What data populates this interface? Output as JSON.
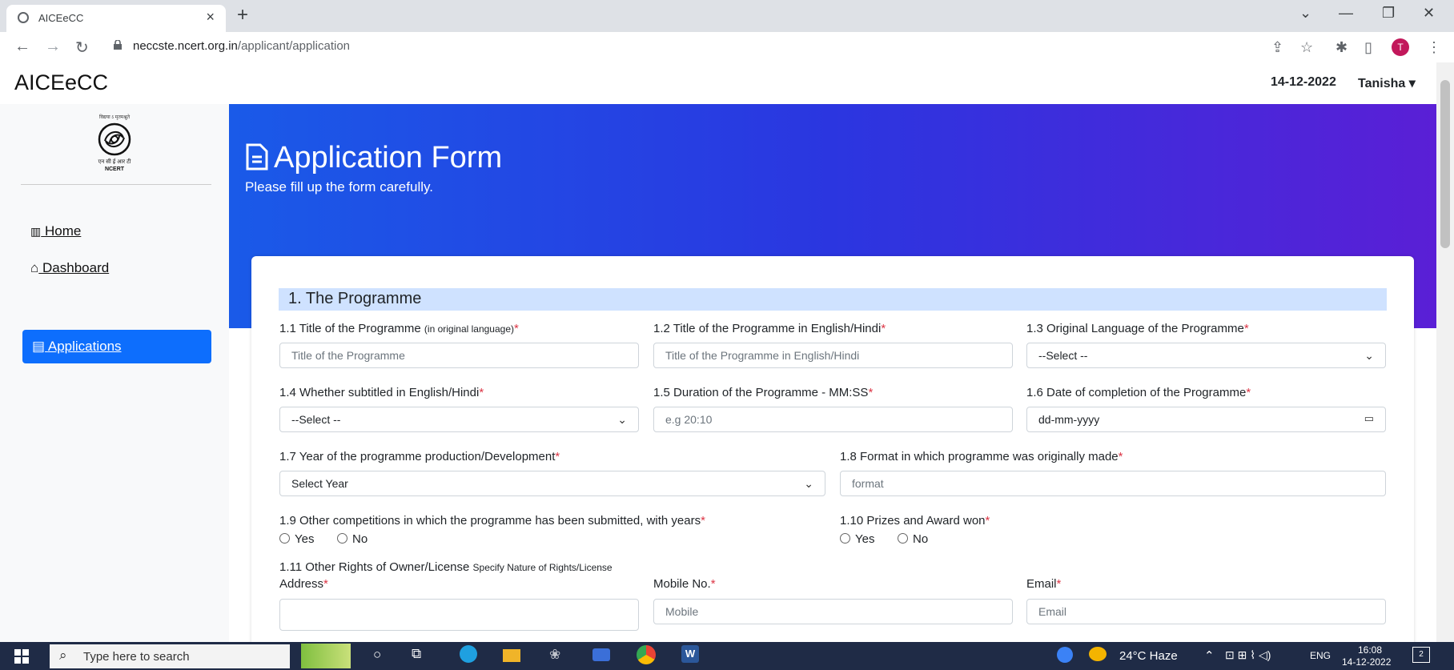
{
  "browser": {
    "tab_title": "AICEeCC",
    "url_host": "neccste.ncert.org.in",
    "url_path": "/applicant/application",
    "profile_initial": "T"
  },
  "navbar": {
    "brand": "AICEeCC",
    "date": "14-12-2022",
    "user": "Tanisha"
  },
  "sidebar": {
    "logo_text_top": "विद्यया ऽ मृतमश्नुते",
    "logo_text_hi": "एन सी ई आर टी",
    "logo_text_en": "NCERT",
    "items": [
      {
        "label": "Home",
        "icon": "chart-icon"
      },
      {
        "label": "Dashboard",
        "icon": "home-icon"
      },
      {
        "label": "Applications",
        "icon": "file-icon",
        "active": true
      }
    ]
  },
  "hero": {
    "title": "Application Form",
    "subtitle": "Please fill up the form carefully."
  },
  "form": {
    "section_title": "1. The Programme",
    "f1_1": {
      "label": "1.1 Title of the Programme",
      "note": "(in original language)",
      "placeholder": "Title of the Programme"
    },
    "f1_2": {
      "label": "1.2 Title of the Programme in English/Hindi",
      "placeholder": "Title of the Programme in English/Hindi"
    },
    "f1_3": {
      "label": "1.3 Original Language of the Programme",
      "value": "--Select --"
    },
    "f1_4": {
      "label": "1.4 Whether subtitled in English/Hindi",
      "value": "--Select --"
    },
    "f1_5": {
      "label": "1.5 Duration of the Programme - MM:SS",
      "placeholder": "e.g 20:10"
    },
    "f1_6": {
      "label": "1.6 Date of completion of the Programme",
      "placeholder": "dd-mm-yyyy"
    },
    "f1_7": {
      "label": "1.7 Year of the programme production/Development",
      "value": "Select Year"
    },
    "f1_8": {
      "label": "1.8 Format in which programme was originally made",
      "placeholder": "format"
    },
    "f1_9": {
      "label": "1.9 Other competitions in which the programme has been submitted, with years"
    },
    "f1_10": {
      "label": "1.10 Prizes and Award won"
    },
    "radio_yes": "Yes",
    "radio_no": "No",
    "f1_11": {
      "label": "1.11 Other Rights of Owner/License",
      "note": "Specify Nature of Rights/License"
    },
    "address": {
      "label": "Address"
    },
    "mobile": {
      "label": "Mobile No.",
      "placeholder": "Mobile"
    },
    "email": {
      "label": "Email",
      "placeholder": "Email"
    },
    "required_mark": "*"
  },
  "taskbar": {
    "search_placeholder": "Type here to search",
    "weather": "24°C  Haze",
    "lang": "ENG",
    "time": "16:08",
    "date": "14-12-2022",
    "notif_count": "2"
  },
  "colors": {
    "primary": "#0d6efd",
    "hero_start": "#1a5ae8",
    "hero_end": "#5a1fd6",
    "section_bg": "#cfe2ff",
    "required": "#dc3545"
  }
}
